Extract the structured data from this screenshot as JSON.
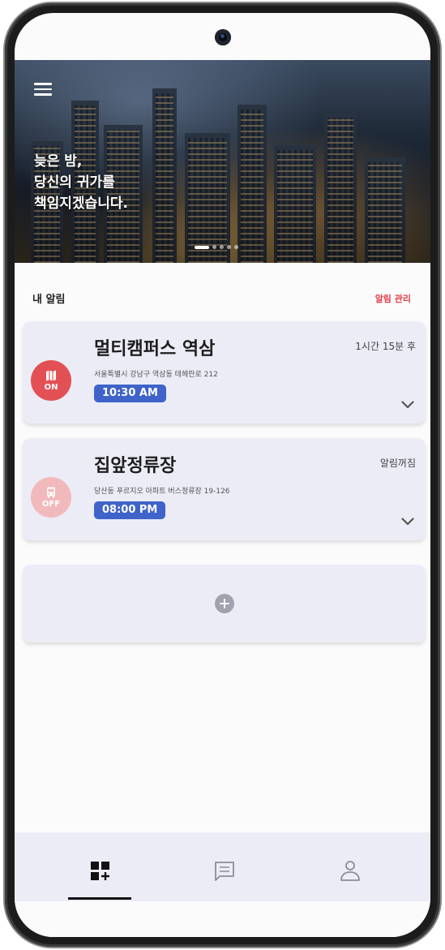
{
  "hero": {
    "headline": "늦은 밤,\n당신의 귀가를\n책임지겠습니다.",
    "slides_total": 5,
    "active_slide": 1
  },
  "alarms": {
    "section_title": "내 알림",
    "manage_label": "알림 관리",
    "items": [
      {
        "title": "멀티캠퍼스 역삼",
        "address": "서울특별시 강남구 역삼동 테헤란로 212",
        "time": "10:30 AM",
        "status": "1시간 15분 후",
        "state_label": "ON",
        "icon": "map-icon",
        "state_color": "#e25055"
      },
      {
        "title": "집앞정류장",
        "address": "당산동 푸르지오 아파트 버스정류장 19-126",
        "time": "08:00 PM",
        "status": "알림꺼짐",
        "state_label": "OFF",
        "icon": "bus-icon",
        "state_color": "#f2b9bd"
      }
    ]
  },
  "bottom_nav": {
    "items": [
      {
        "icon": "dashboard-add-icon",
        "active": true
      },
      {
        "icon": "chat-icon",
        "active": false
      },
      {
        "icon": "profile-icon",
        "active": false
      }
    ]
  },
  "colors": {
    "accent": "#3f63c9",
    "on_state": "#e25055",
    "off_state": "#f2b9bd",
    "manage_link": "#e0414a",
    "card_bg": "#ebecf6"
  }
}
